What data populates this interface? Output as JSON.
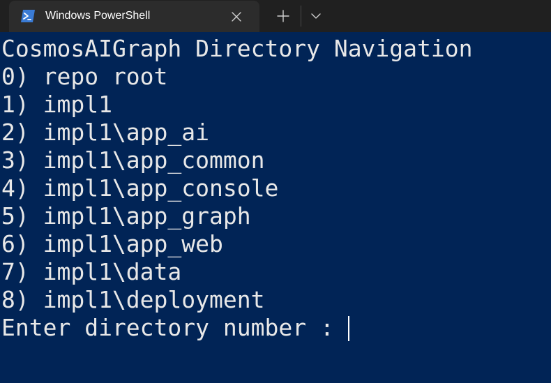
{
  "tab": {
    "title": "Windows PowerShell",
    "icon": "powershell-icon"
  },
  "toolbar": {
    "new_tab_icon": "plus-icon",
    "dropdown_icon": "chevron-down-icon"
  },
  "colors": {
    "terminal_background": "#012456",
    "tabbar_background": "#202020",
    "active_tab_background": "#2c2c2c",
    "text": "#e8e8e8"
  },
  "terminal": {
    "heading": "CosmosAIGraph Directory Navigation",
    "options": [
      "0) repo root",
      "1) impl1",
      "2) impl1\\app_ai",
      "3) impl1\\app_common",
      "4) impl1\\app_console",
      "5) impl1\\app_graph",
      "6) impl1\\app_web",
      "7) impl1\\data",
      "8) impl1\\deployment"
    ],
    "prompt": "Enter directory number : "
  }
}
